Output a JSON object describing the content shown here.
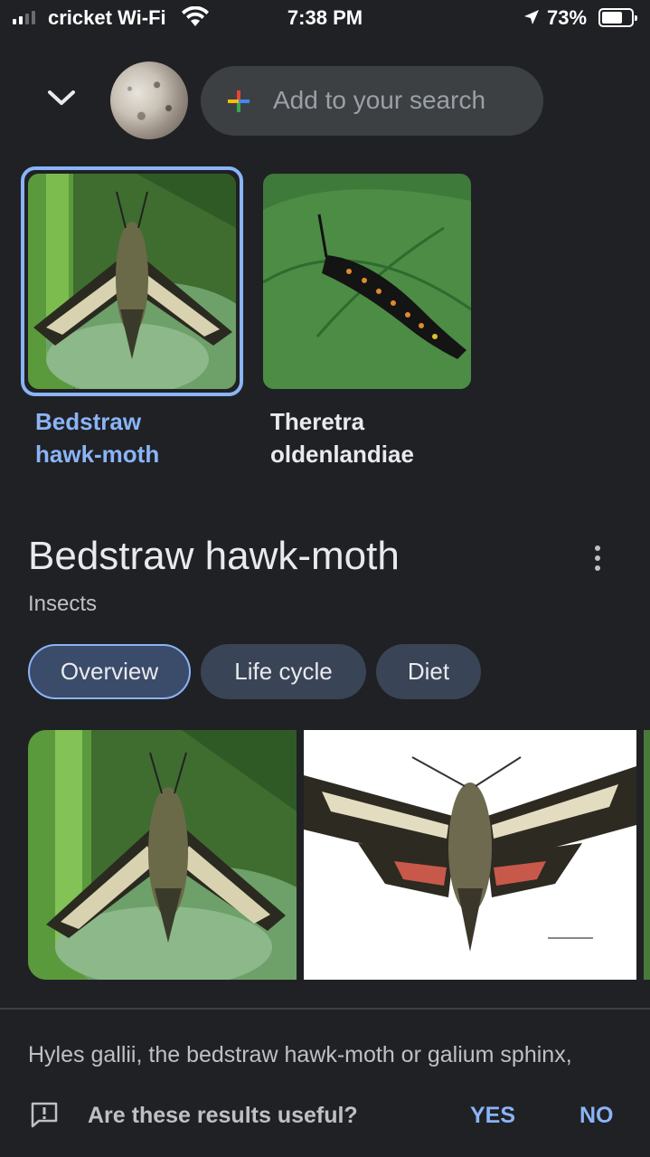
{
  "status_bar": {
    "carrier": "cricket Wi-Fi",
    "time": "7:38 PM",
    "battery_percent": "73%",
    "battery_level": 0.73,
    "signal_bars_active": 2,
    "signal_bars_total": 4
  },
  "search": {
    "add_placeholder": "Add to your search"
  },
  "candidates": [
    {
      "label": "Bedstraw hawk-moth",
      "selected": true
    },
    {
      "label": "Theretra oldenlandiae",
      "selected": false
    }
  ],
  "panel": {
    "title": "Bedstraw hawk-moth",
    "subtitle": "Insects",
    "chips": [
      "Overview",
      "Life cycle",
      "Diet"
    ],
    "active_chip": "Overview",
    "description": "Hyles gallii, the bedstraw hawk-moth or galium sphinx,"
  },
  "feedback": {
    "question": "Are these results useful?",
    "yes": "YES",
    "no": "NO"
  },
  "colors": {
    "background": "#202124",
    "accent": "#8ab4f8",
    "chip": "#394457",
    "search_pill": "#3c4043"
  }
}
